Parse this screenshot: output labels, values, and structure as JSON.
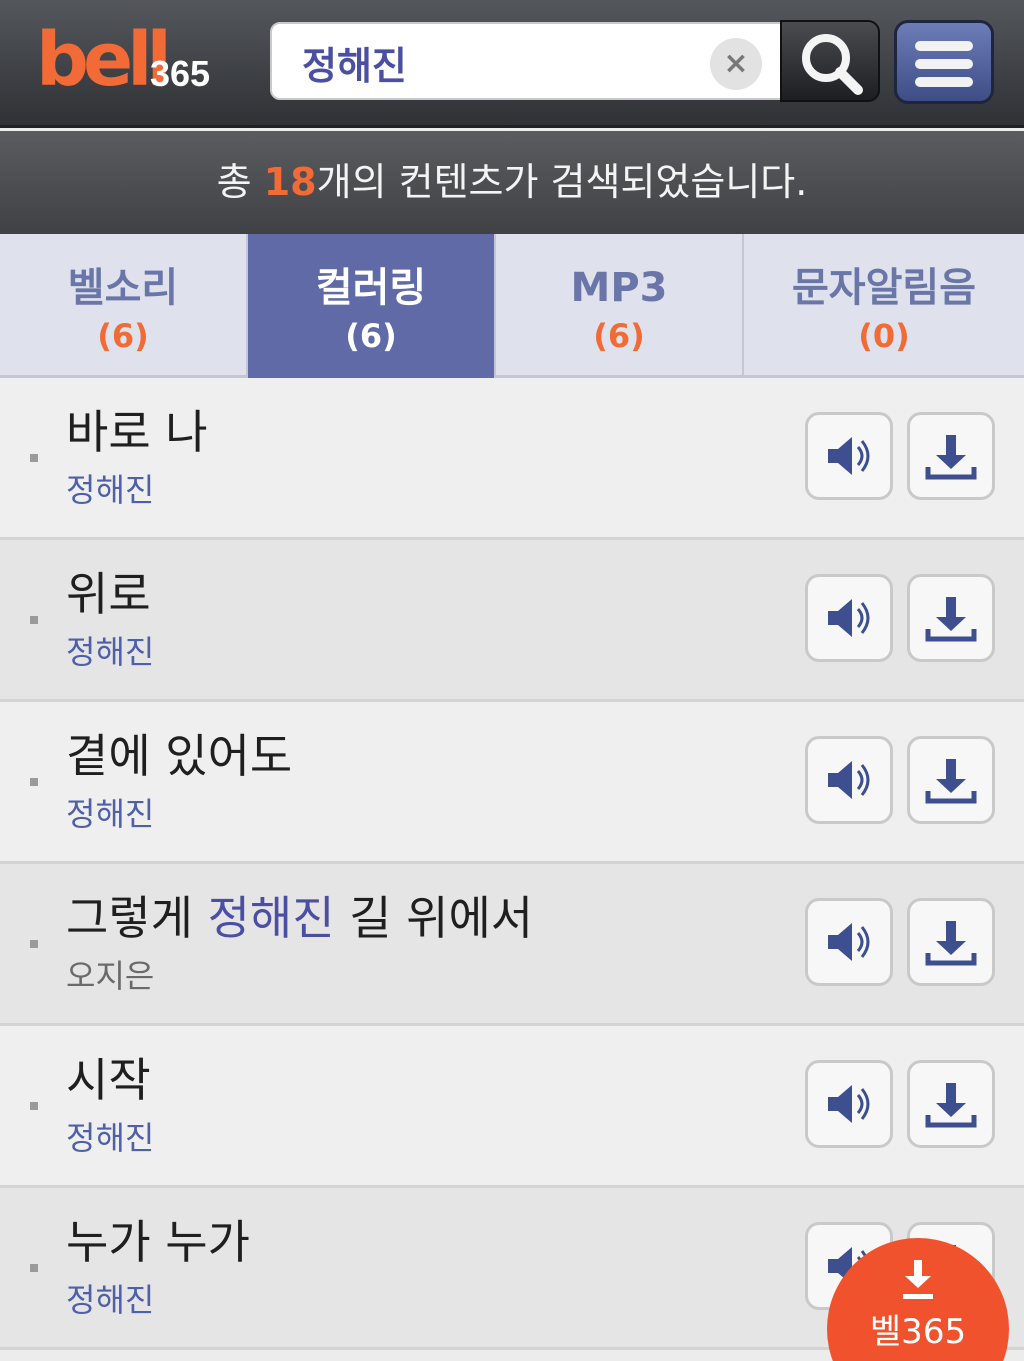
{
  "header": {
    "logo_main": "bell",
    "logo_num": "365",
    "search_value": "정해진",
    "clear_symbol": "×",
    "search_icon": "search-icon",
    "menu_icon": "hamburger-menu-icon"
  },
  "summary": {
    "prefix": "총 ",
    "count": "18",
    "suffix": "개의 컨텐츠가 검색되었습니다."
  },
  "tabs": [
    {
      "label": "벨소리",
      "count": "(6)",
      "active": false
    },
    {
      "label": "컬러링",
      "count": "(6)",
      "active": true
    },
    {
      "label": "MP3",
      "count": "(6)",
      "active": false
    },
    {
      "label": "문자알림음",
      "count": "(0)",
      "active": false
    }
  ],
  "results": [
    {
      "title_before": "바로 나",
      "title_hl": "",
      "title_after": "",
      "artist": "정해진"
    },
    {
      "title_before": "위로",
      "title_hl": "",
      "title_after": "",
      "artist": "정해진"
    },
    {
      "title_before": "곁에 있어도",
      "title_hl": "",
      "title_after": "",
      "artist": "정해진"
    },
    {
      "title_before": "그렇게 ",
      "title_hl": "정해진",
      "title_after": " 길 위에서",
      "artist": "오지은"
    },
    {
      "title_before": "시작",
      "title_hl": "",
      "title_after": "",
      "artist": "정해진"
    },
    {
      "title_before": "누가 누가",
      "title_hl": "",
      "title_after": "",
      "artist": "정해진"
    }
  ],
  "icons": {
    "play": "speaker-icon",
    "download": "download-icon"
  },
  "float_badge": {
    "text": "벨365"
  },
  "colors": {
    "accent_orange": "#f26a35",
    "tab_active": "#5f6aa6",
    "artist_blue": "#4f5fa8"
  }
}
